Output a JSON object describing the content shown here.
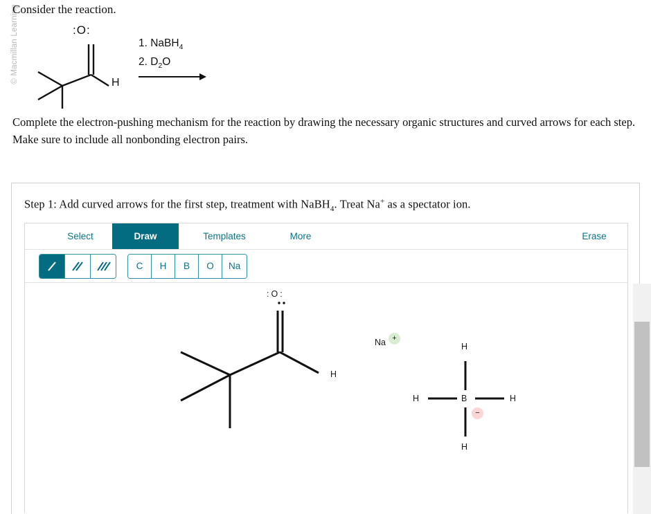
{
  "watermark": "© Macmillan Learning",
  "prompt": {
    "heading": "Consider the reaction.",
    "instructions": "Complete the electron-pushing mechanism for the reaction by drawing the necessary organic structures and curved arrows for each step. Make sure to include all nonbonding electron pairs."
  },
  "reaction_scheme": {
    "reagent_line_1": "1. NaBH",
    "reagent_line_1_sub": "4",
    "reagent_line_2_a": "2. D",
    "reagent_line_2_sub": "2",
    "reagent_line_2_b": "O",
    "substrate_name": "pivaldehyde",
    "oxygen_label": "O",
    "aldehyde_h_label": "H",
    "arrow": "reaction-arrow"
  },
  "step": {
    "title_a": "Step 1: Add curved arrows for the first step, treatment with NaBH",
    "title_sub": "4",
    "title_b": ". Treat Na",
    "title_sup": "+",
    "title_c": " as a spectator ion."
  },
  "editor": {
    "tabs": [
      {
        "label": "Select",
        "active": false
      },
      {
        "label": "Draw",
        "active": true
      },
      {
        "label": "Templates",
        "active": false
      },
      {
        "label": "More",
        "active": false
      }
    ],
    "erase_label": "Erase",
    "bond_tools": [
      {
        "name": "single-bond",
        "selected": true
      },
      {
        "name": "double-bond",
        "selected": false
      },
      {
        "name": "triple-bond",
        "selected": false
      }
    ],
    "element_tools": [
      "C",
      "H",
      "B",
      "O",
      "Na"
    ],
    "accent_color": "#046C80",
    "link_color": "#0a7489"
  },
  "canvas": {
    "aldehyde": {
      "oxygen_label": "O",
      "oxygen_lone_pair_left": ":",
      "oxygen_lone_pair_right": ":",
      "hydrogen_label": "H"
    },
    "sodium": {
      "symbol": "Na",
      "charge": "+",
      "charge_color": "#d8edd2"
    },
    "borohydride": {
      "center_label": "B",
      "hydrogens": [
        "H",
        "H",
        "H",
        "H"
      ],
      "charge": "−",
      "charge_color": "#fbd6d6"
    }
  },
  "scrollbar": {
    "name": "vertical-scrollbar",
    "thumb": "scroll-thumb"
  }
}
